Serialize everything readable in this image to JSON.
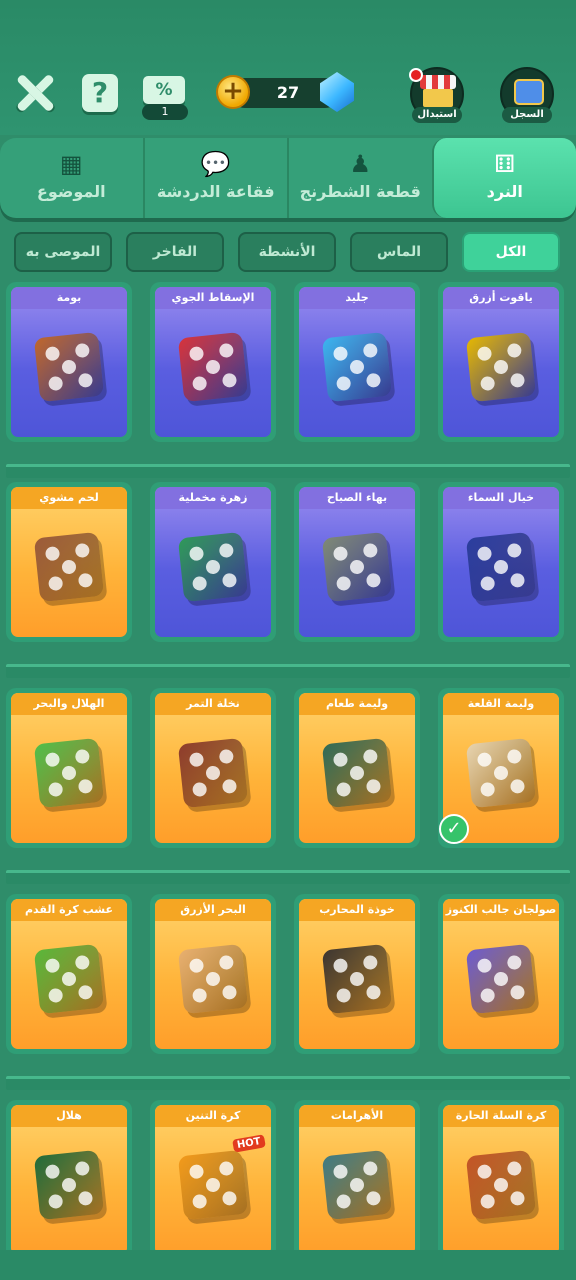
{
  "header": {
    "ticket_count": "1",
    "coins": "27",
    "shop_label": "استبدال",
    "record_label": "السجل",
    "ticket_symbol": "%",
    "help_symbol": "?"
  },
  "tabs": [
    {
      "label": "النرد",
      "icon": "dice-icon",
      "active": true
    },
    {
      "label": "قطعة الشطرنج",
      "icon": "chess-piece-icon",
      "active": false
    },
    {
      "label": "فقاعة الدردشة",
      "icon": "chat-bubble-icon",
      "active": false
    },
    {
      "label": "الموضوع",
      "icon": "theme-grid-icon",
      "active": false
    }
  ],
  "filters": [
    "الكل",
    "الماس",
    "الأنشطة",
    "الفاخر",
    "الموصى به"
  ],
  "rows": [
    {
      "items": [
        {
          "title": "ياقوت أزرق",
          "style": "blue",
          "color": "#e6b800"
        },
        {
          "title": "جليد",
          "style": "blue",
          "color": "#3bb6f0"
        },
        {
          "title": "الإسقاط الجوي",
          "style": "blue",
          "color": "#d8333a"
        },
        {
          "title": "بومة",
          "style": "blue",
          "color": "#c0672b"
        }
      ]
    },
    {
      "items": [
        {
          "title": "خيال السماء",
          "style": "blue",
          "color": "#2a3d9e"
        },
        {
          "title": "بهاء الصباح",
          "style": "blue",
          "color": "#7f8a75"
        },
        {
          "title": "زهرة مخملية",
          "style": "blue",
          "color": "#2e9a58"
        },
        {
          "title": "لحم مشوي",
          "style": "orange",
          "color": "#9c5a3a"
        }
      ]
    },
    {
      "items": [
        {
          "title": "وليمة القلعة",
          "style": "orange",
          "color": "#e8d4b0"
        },
        {
          "title": "وليمة طعام",
          "style": "orange",
          "color": "#2f6b57"
        },
        {
          "title": "نخلة التمر",
          "style": "orange",
          "color": "#8e3b2c"
        },
        {
          "title": "الهلال والبحر",
          "style": "orange",
          "color": "#4fbf4a"
        }
      ]
    },
    {
      "items": [
        {
          "title": "صولجان جالب الكنوز",
          "style": "orange",
          "color": "#6d5bd0"
        },
        {
          "title": "خوذة المحارب",
          "style": "orange",
          "color": "#3c3530"
        },
        {
          "title": "البحر الأزرق",
          "style": "orange",
          "color": "#e9b070"
        },
        {
          "title": "عشب كرة القدم",
          "style": "orange",
          "color": "#58b83a"
        }
      ]
    },
    {
      "items": [
        {
          "title": "كرة السلة الحارة",
          "style": "orange",
          "color": "#c45426"
        },
        {
          "title": "الأهرامات",
          "style": "orange",
          "color": "#3e7b84"
        },
        {
          "title": "كرة التنين",
          "style": "orange",
          "color": "#f39a1a"
        },
        {
          "title": "هلال",
          "style": "orange",
          "color": "#1f6c3a"
        }
      ]
    }
  ],
  "selected_item": "وليمة القلعة",
  "hot_badge": "HOT",
  "hot_item": "كرة التنين"
}
